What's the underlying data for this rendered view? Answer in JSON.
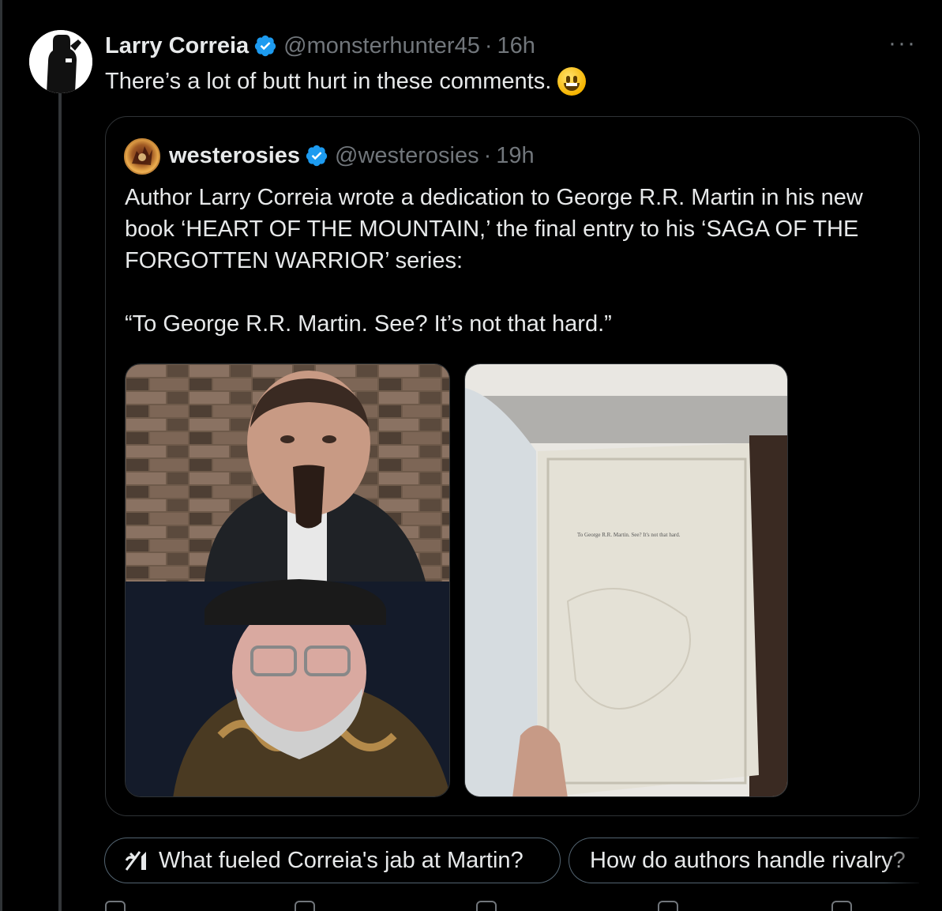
{
  "tweet": {
    "display_name": "Larry Correia",
    "handle": "@monsterhunter45",
    "separator": "·",
    "time": "16h",
    "text": "There’s a lot of butt hurt in these comments.",
    "more_label": "···",
    "emoji_icon": "grinning-face-emoji"
  },
  "quoted": {
    "display_name": "westerosies",
    "handle": "@westerosies",
    "separator": "·",
    "time": "19h",
    "paragraph1": "Author Larry Correia wrote a dedication to George R.R. Martin in his new book ‘HEART OF THE MOUNTAIN,’ the final entry to his ‘SAGA OF THE FORGOTTEN WARRIOR’ series:",
    "paragraph2": "“To George R.R. Martin. See? It’s not that hard.”",
    "book_page_text": "To George R.R. Martin. See? It's not that hard."
  },
  "suggestions": [
    {
      "label": "What fueled Correia's jab at Martin?"
    },
    {
      "label": "How do authors handle rivalry?"
    }
  ],
  "colors": {
    "verified": "#1d9bf0",
    "muted": "#71767b",
    "border": "#2f3336"
  }
}
